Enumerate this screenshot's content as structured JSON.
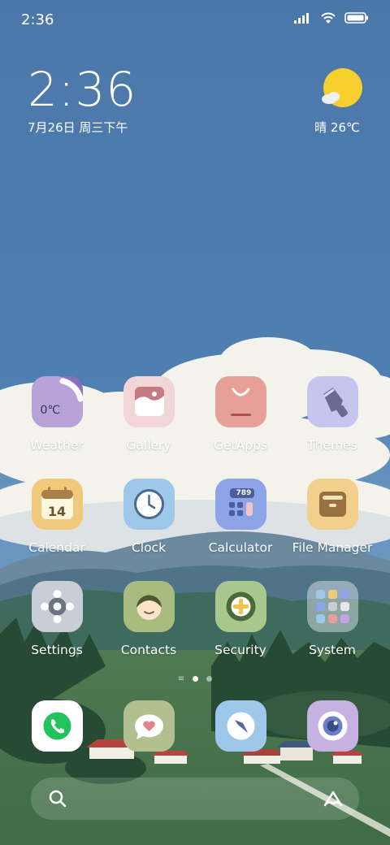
{
  "status": {
    "time": "2:36"
  },
  "clock_widget": {
    "time": "2:36",
    "date": "7月26日 周三下午"
  },
  "weather_widget": {
    "text": "晴 26℃"
  },
  "apps": [
    {
      "name": "weather",
      "label": "Weather",
      "badge": "0℃"
    },
    {
      "name": "gallery",
      "label": "Gallery"
    },
    {
      "name": "getapps",
      "label": "GetApps"
    },
    {
      "name": "themes",
      "label": "Themes"
    },
    {
      "name": "calendar",
      "label": "Calendar",
      "badge": "14"
    },
    {
      "name": "clock",
      "label": "Clock"
    },
    {
      "name": "calculator",
      "label": "Calculator",
      "badge": "789"
    },
    {
      "name": "file-manager",
      "label": "File Manager"
    },
    {
      "name": "settings",
      "label": "Settings"
    },
    {
      "name": "contacts",
      "label": "Contacts"
    },
    {
      "name": "security",
      "label": "Security"
    },
    {
      "name": "system",
      "label": "System"
    }
  ],
  "dock": [
    {
      "name": "phone"
    },
    {
      "name": "messaging"
    },
    {
      "name": "browser"
    },
    {
      "name": "camera"
    }
  ],
  "colors": {
    "sky": "#4a7aad",
    "sun": "#f7cf2f"
  }
}
